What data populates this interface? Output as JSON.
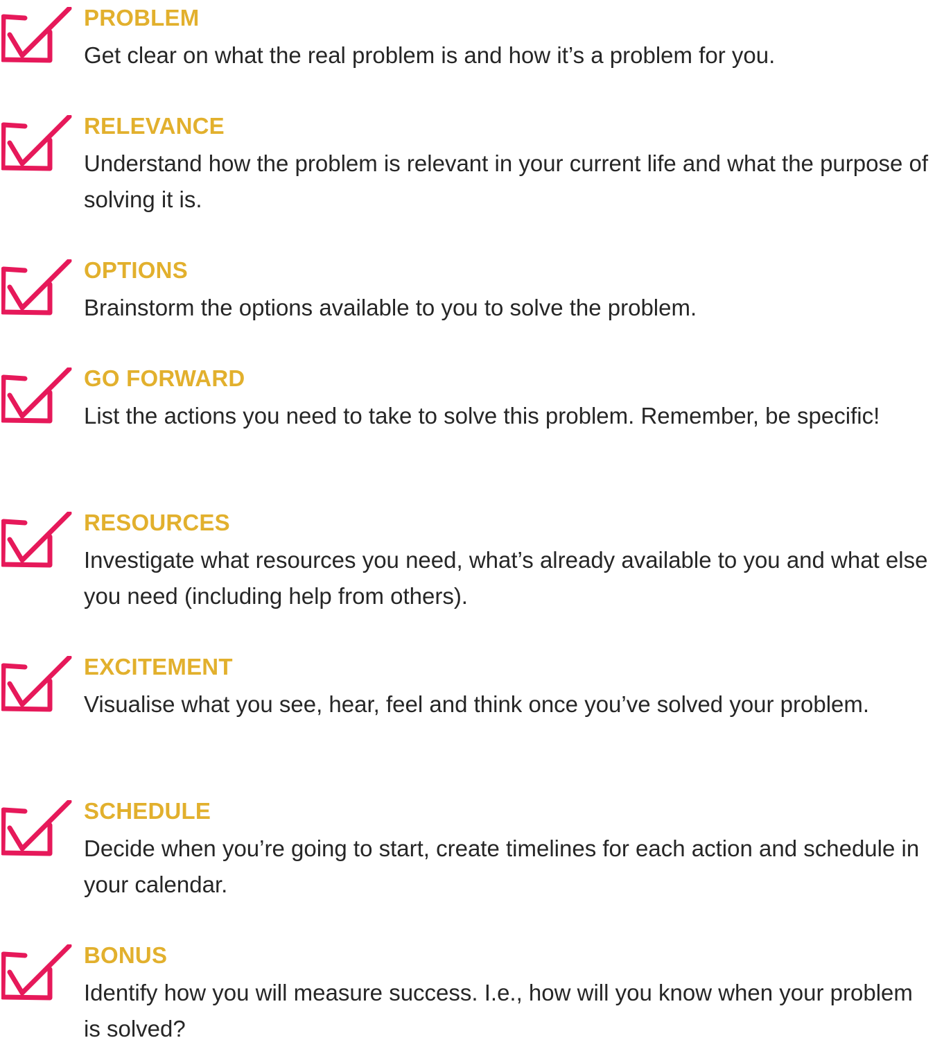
{
  "colors": {
    "heading": "#e2b02d",
    "check": "#e6195a",
    "text": "#262626"
  },
  "icon": "checkbox-checked-icon",
  "items": [
    {
      "heading": "PROBLEM",
      "text": "Get clear on what the real problem is and how it’s a problem for you."
    },
    {
      "heading": "RELEVANCE",
      "text": "Understand how the problem is relevant in your current life and what the purpose of solving it is."
    },
    {
      "heading": "OPTIONS",
      "text": "Brainstorm the options available to you to solve the problem."
    },
    {
      "heading": "GO FORWARD",
      "text": "List the actions you need to take to solve this problem. Remember, be specific!"
    },
    {
      "heading": "RESOURCES",
      "text": "Investigate what resources you need, what’s already available to you and what else you need (including help from others)."
    },
    {
      "heading": "EXCITEMENT",
      "text": "Visualise what you see, hear, feel and think once you’ve solved your problem."
    },
    {
      "heading": "SCHEDULE",
      "text": "Decide when you’re going to start, create timelines for each action and schedule in your calendar."
    },
    {
      "heading": "BONUS",
      "text": "Identify how you will measure success. I.e., how will you know when your problem is solved?"
    }
  ]
}
